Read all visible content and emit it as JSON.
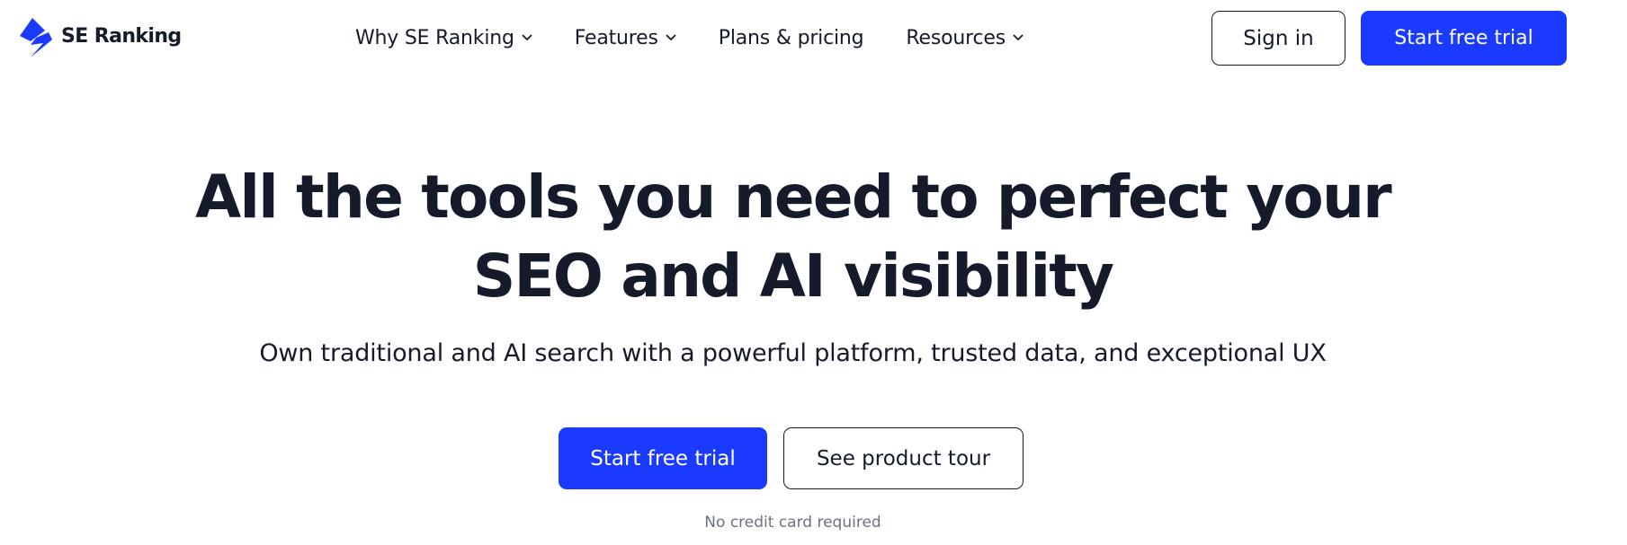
{
  "brand": {
    "name": "SE Ranking",
    "logo_icon": "lightning-bolt-icon",
    "accent_color": "#1a3bff",
    "text_color": "#151b2b"
  },
  "nav": {
    "items": [
      {
        "label": "Why SE Ranking",
        "has_dropdown": true
      },
      {
        "label": "Features",
        "has_dropdown": true
      },
      {
        "label": "Plans & pricing",
        "has_dropdown": false
      },
      {
        "label": "Resources",
        "has_dropdown": true
      }
    ],
    "dropdown_icon": "chevron-down-icon"
  },
  "header_actions": {
    "sign_in_label": "Sign in",
    "start_trial_label": "Start free trial"
  },
  "hero": {
    "title_lines": [
      "All the tools you need to perfect your",
      "SEO and AI visibility"
    ],
    "subtitle": "Own traditional and AI search with a powerful platform, trusted data, and exceptional UX",
    "primary_cta_label": "Start free trial",
    "secondary_cta_label": "See product tour",
    "note": "No credit card required"
  }
}
